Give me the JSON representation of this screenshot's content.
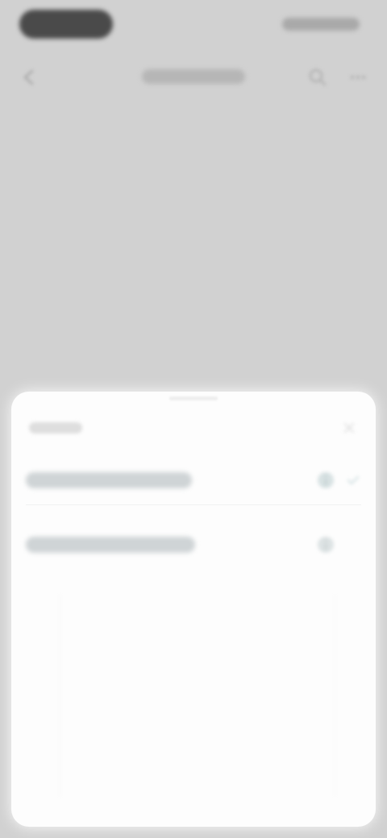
{
  "status_bar": {
    "time": "",
    "indicators": ""
  },
  "nav": {
    "title": "",
    "back_icon": "back-arrow-icon",
    "action_1_icon": "search-icon",
    "action_2_icon": "more-icon"
  },
  "sheet": {
    "title": "",
    "close_icon": "close-icon",
    "options": [
      {
        "label": "",
        "icon": "info-icon",
        "selected": true
      },
      {
        "label": "",
        "icon": "info-icon",
        "selected": false
      }
    ]
  },
  "colors": {
    "background": "#d1d1d1",
    "sheet": "#fdfdfd",
    "accent": "#c9d6d8"
  }
}
